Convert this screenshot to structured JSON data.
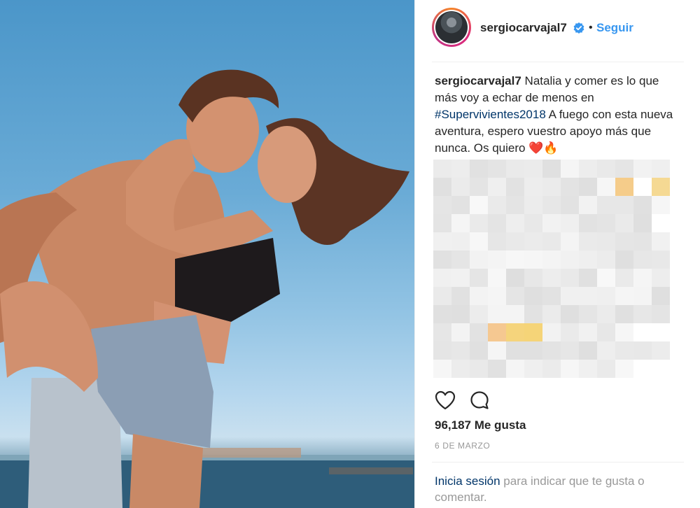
{
  "post": {
    "username": "sergiocarvajal7",
    "follow_label": "Seguir",
    "separator": "•",
    "caption": {
      "username": "sergiocarvajal7",
      "text_before": " Natalia y comer es lo que más voy a echar de menos en ",
      "hashtag": "#Supervivientes2018",
      "text_after": " A fuego con esta nueva aventura, espero vuestro apoyo más que nunca. Os quiero ",
      "emojis": "❤️🔥"
    },
    "likes_text": "96,187 Me gusta",
    "date_text": "6 DE MARZO",
    "login": {
      "link_text": "Inicia sesión",
      "rest_text": " para indicar que te gusta o comentar."
    }
  },
  "icons": {
    "verified": "verified-badge-icon",
    "like": "heart-icon",
    "comment": "comment-icon"
  },
  "colors": {
    "link_blue": "#3897f0",
    "hashtag_blue": "#003569",
    "muted_gray": "#999999"
  }
}
